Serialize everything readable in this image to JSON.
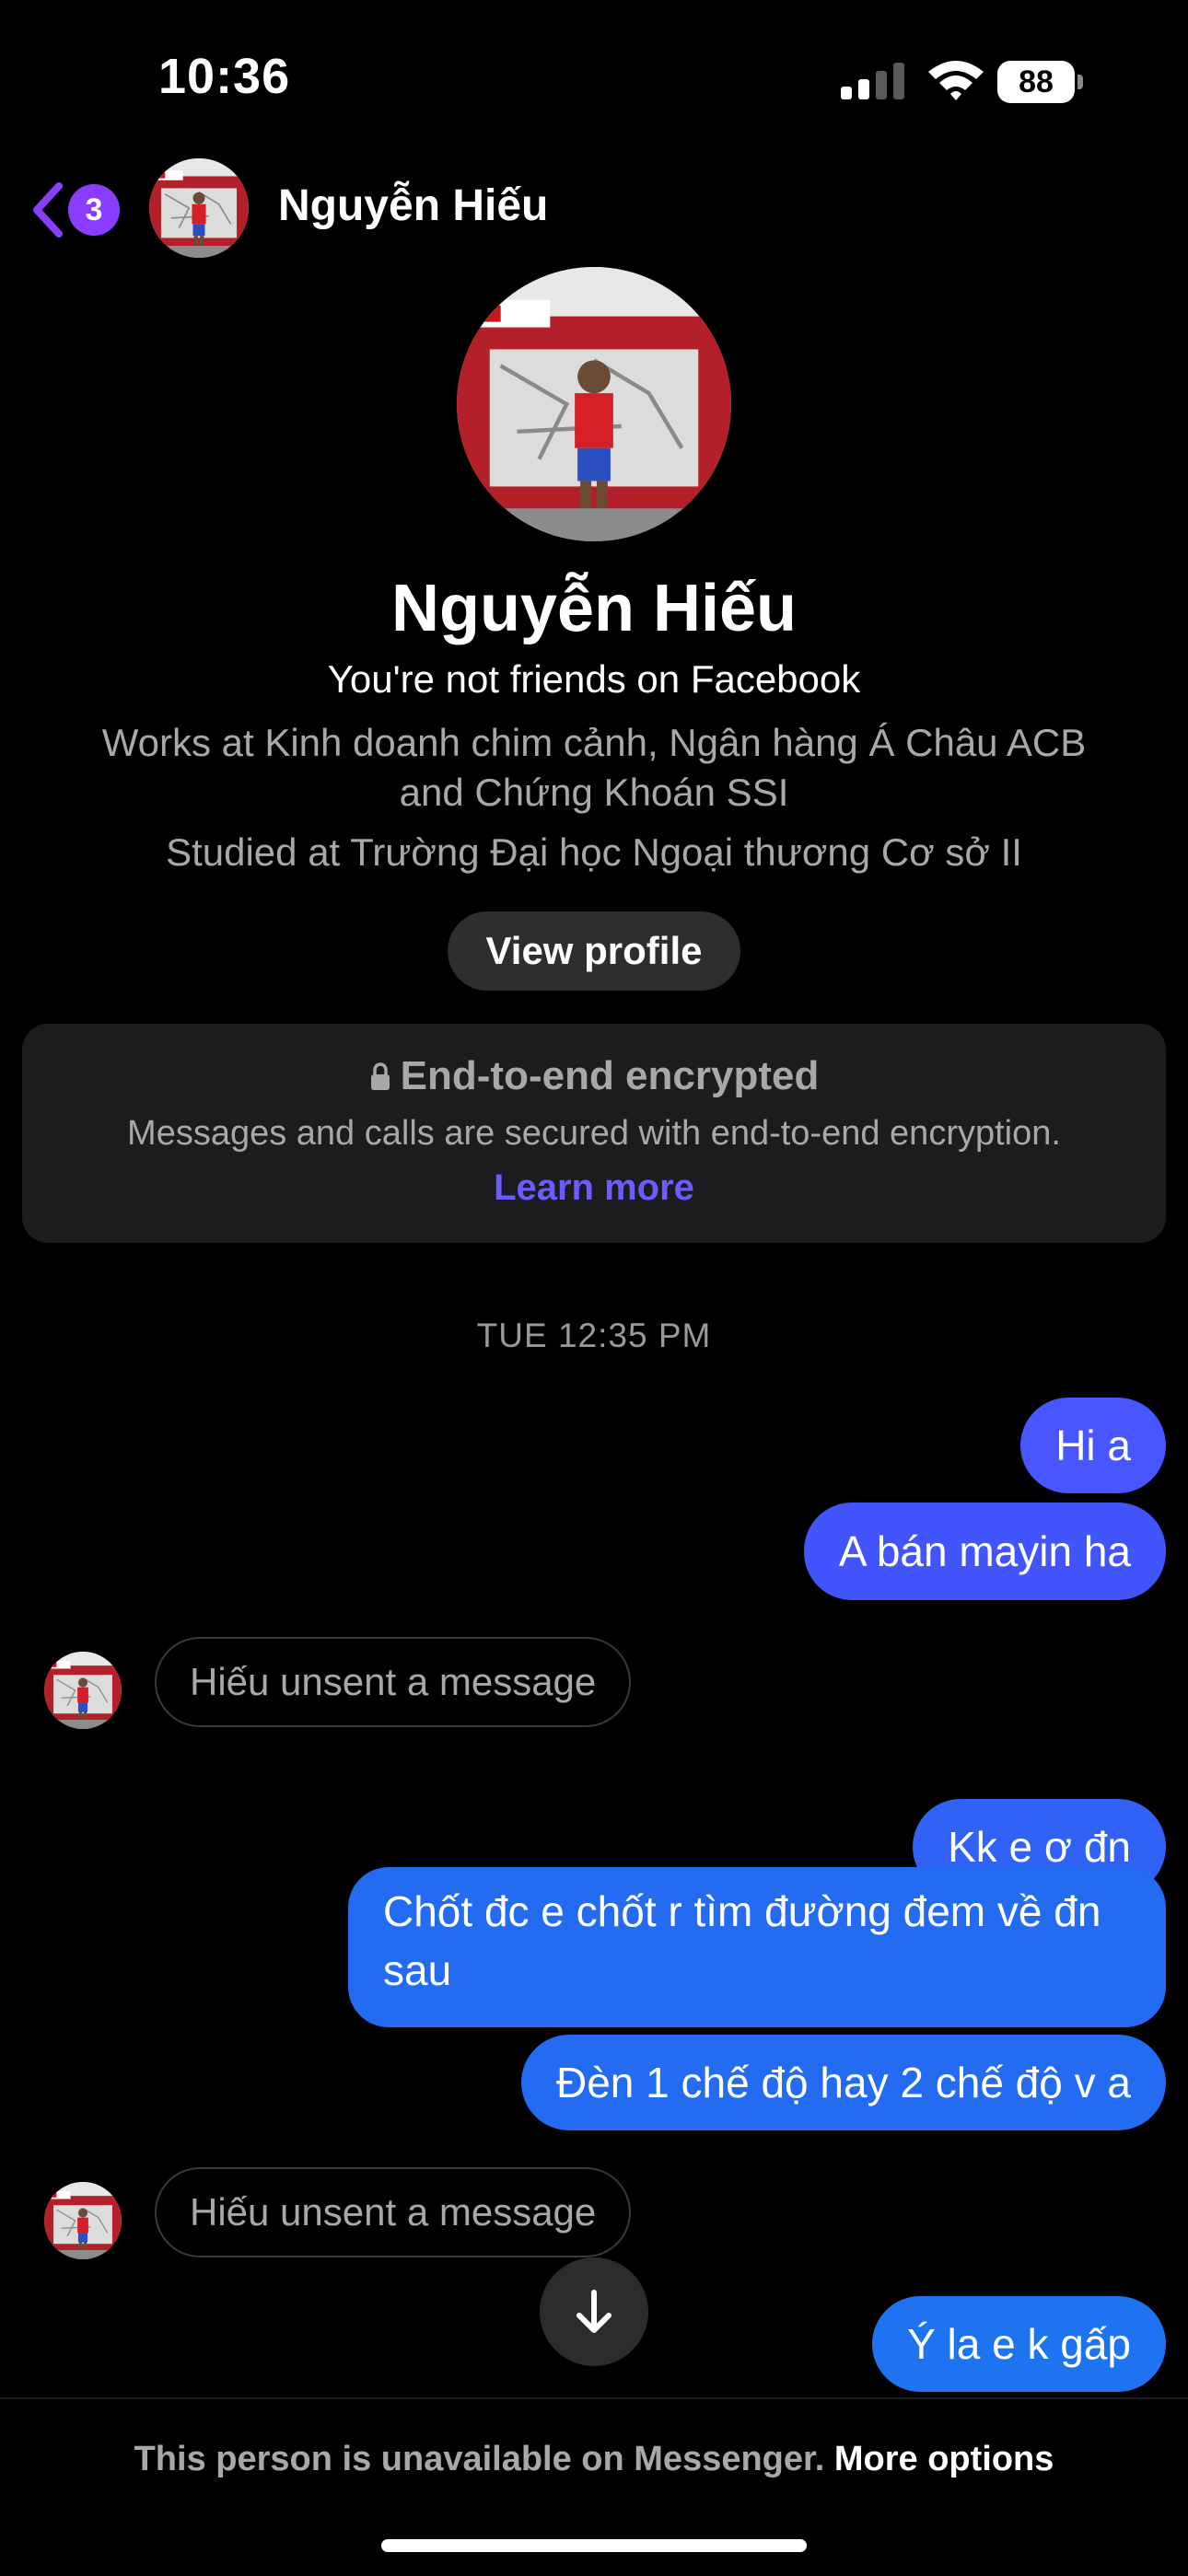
{
  "status_bar": {
    "time": "10:36",
    "battery": "88"
  },
  "header": {
    "back_badge": "3",
    "name": "Nguyễn Hiếu"
  },
  "profile": {
    "name": "Nguyễn Hiếu",
    "relationship": "You're not friends on Facebook",
    "works": "Works at Kinh doanh chim cảnh, Ngân hàng Á Châu ACB and Chứng Khoán SSI",
    "studied": "Studied at Trường Đại học Ngoại thương Cơ sở II",
    "view_profile_label": "View profile"
  },
  "encryption": {
    "title": "End-to-end encrypted",
    "description": "Messages and calls are secured with end-to-end encryption.",
    "link": "Learn more"
  },
  "conversation": {
    "timestamp": "TUE 12:35 PM",
    "messages": [
      {
        "side": "sent",
        "text": "Hi a"
      },
      {
        "side": "sent",
        "text": "A bán mayin ha"
      },
      {
        "side": "received",
        "text": "Hiếu unsent a message"
      },
      {
        "side": "sent",
        "text": "Kk e ơ đn"
      },
      {
        "side": "sent",
        "text": "Chốt đc e chốt r tìm đường đem về đn sau"
      },
      {
        "side": "sent",
        "text": "Đèn 1 chế độ hay 2 chế độ v a"
      },
      {
        "side": "received",
        "text": "Hiếu unsent a message"
      },
      {
        "side": "sent",
        "text": "Ý la e k gấp"
      }
    ]
  },
  "footer": {
    "unavailable_text": "This person is unavailable on Messenger.",
    "more_options": "More options"
  },
  "colors": {
    "accent": "#8b3dff",
    "link": "#6a5cff",
    "bubble_top": "#4756ff",
    "bubble_bottom": "#1e74f0"
  }
}
